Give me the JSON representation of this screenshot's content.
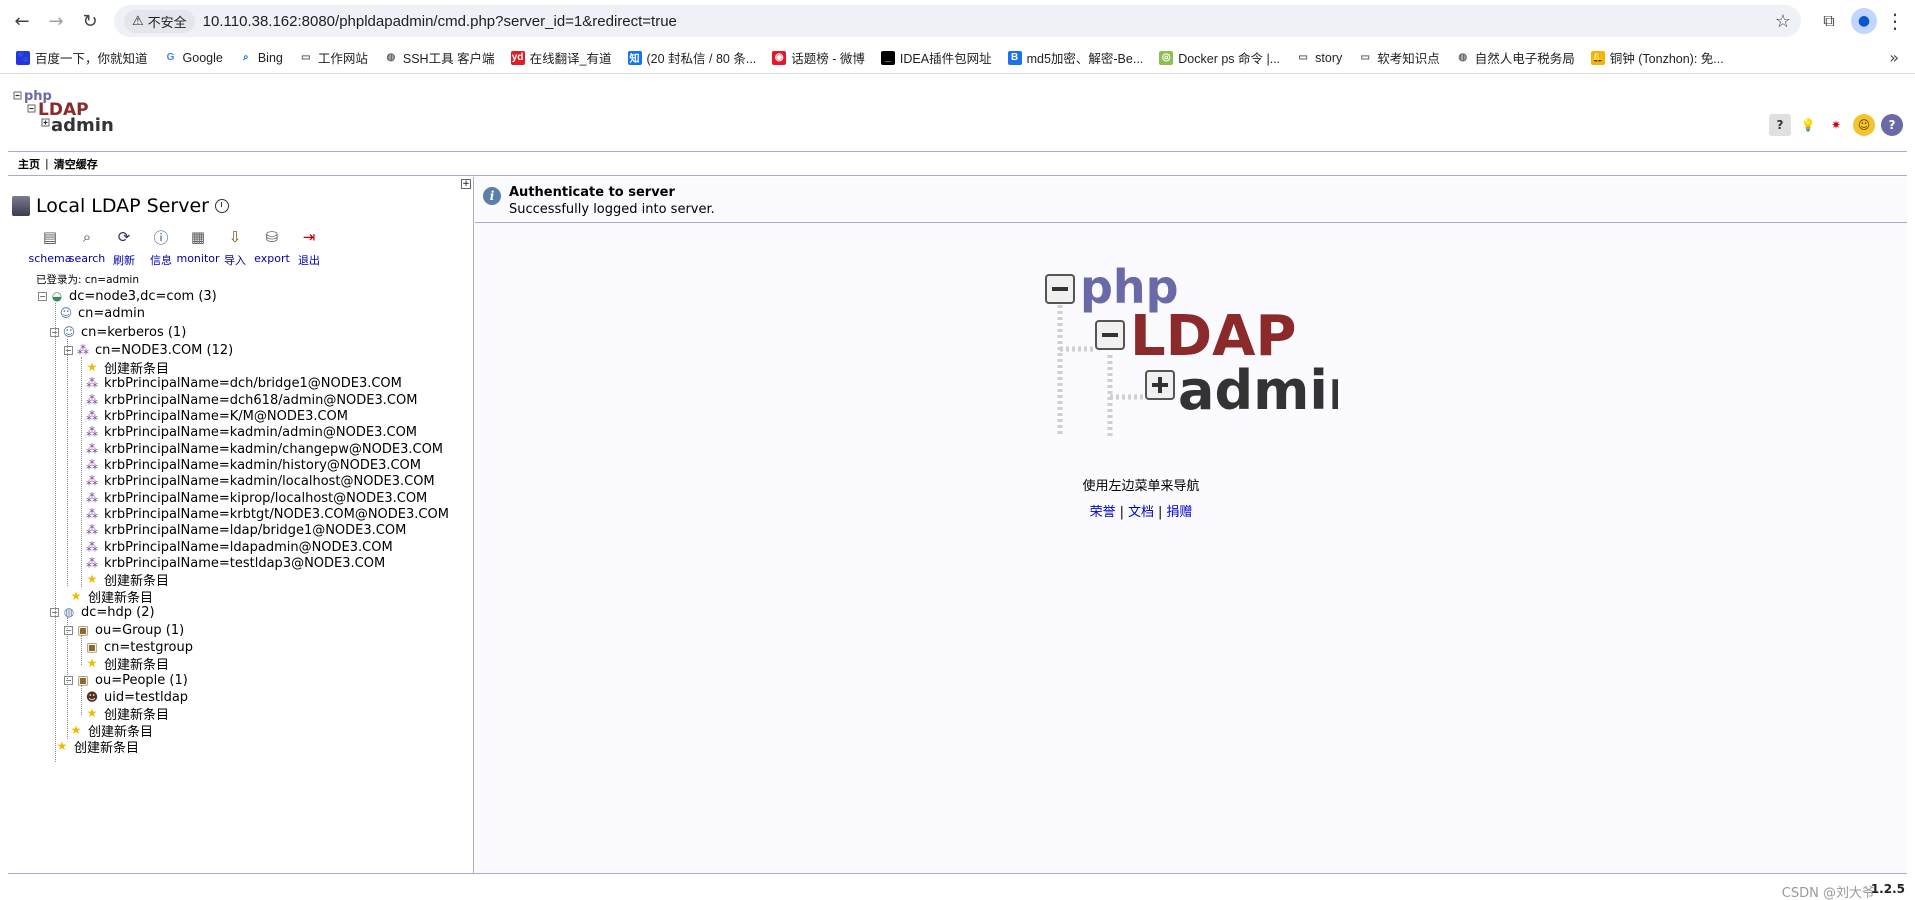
{
  "browser": {
    "secure_label": "不安全",
    "url": "10.110.38.162:8080/phpldapadmin/cmd.php?server_id=1&redirect=true",
    "bookmarks": [
      {
        "label": "百度一下，你就知道",
        "icon": "baidu-icon",
        "color": "#2932e1"
      },
      {
        "label": "Google",
        "icon": "google-icon",
        "color": "#4285f4"
      },
      {
        "label": "Bing",
        "icon": "search-icon",
        "color": "#1a73e8"
      },
      {
        "label": "工作网站",
        "icon": "folder-icon",
        "color": "#5f6368"
      },
      {
        "label": "SSH工具 客户端",
        "icon": "globe-icon",
        "color": "#5f6368"
      },
      {
        "label": "在线翻译_有道",
        "icon": "youdao-icon",
        "color": "#e31b23"
      },
      {
        "label": "(20 封私信 / 80 条...",
        "icon": "zhihu-icon",
        "color": "#1772f6"
      },
      {
        "label": "话题榜 - 微博",
        "icon": "weibo-icon",
        "color": "#e6162d"
      },
      {
        "label": "IDEA插件包网址",
        "icon": "terminal-icon",
        "color": "#000000"
      },
      {
        "label": "md5加密、解密-Be...",
        "icon": "bejson-icon",
        "color": "#1a73e8"
      },
      {
        "label": "Docker ps 命令 |...",
        "icon": "runoob-icon",
        "color": "#8cc152"
      },
      {
        "label": "story",
        "icon": "folder-icon",
        "color": "#5f6368"
      },
      {
        "label": "软考知识点",
        "icon": "folder-icon",
        "color": "#5f6368"
      },
      {
        "label": "自然人电子税务局",
        "icon": "globe-icon",
        "color": "#5f6368"
      },
      {
        "label": "铜钟 (Tonzhon): 免...",
        "icon": "bell-icon",
        "color": "#f4b400"
      }
    ]
  },
  "menubar": {
    "home": "主页",
    "sep": "|",
    "purge": "清空缓存"
  },
  "server": {
    "title": "Local LDAP Server",
    "logged_in": "已登录为: cn=admin"
  },
  "tools": [
    {
      "label": "schema",
      "icon": "schema-icon"
    },
    {
      "label": "search",
      "icon": "search-icon"
    },
    {
      "label": "刷新",
      "icon": "refresh-icon"
    },
    {
      "label": "信息",
      "icon": "info-icon"
    },
    {
      "label": "monitor",
      "icon": "monitor-icon"
    },
    {
      "label": "导入",
      "icon": "import-icon"
    },
    {
      "label": "export",
      "icon": "export-icon"
    },
    {
      "label": "退出",
      "icon": "logout-icon"
    }
  ],
  "tree": [
    {
      "label": "dc=node3,dc=com (3)",
      "icon": "domain-icon"
    },
    {
      "label": "cn=admin",
      "icon": "user-icon"
    },
    {
      "label": "cn=kerberos (1)",
      "icon": "user-icon"
    },
    {
      "label": "cn=NODE3.COM (12)",
      "icon": "group-icon"
    },
    {
      "label": "创建新条目",
      "icon": "star-icon"
    },
    {
      "label": "krbPrincipalName=dch/bridge1@NODE3.COM",
      "icon": "group-icon"
    },
    {
      "label": "krbPrincipalName=dch618/admin@NODE3.COM",
      "icon": "group-icon"
    },
    {
      "label": "krbPrincipalName=K/M@NODE3.COM",
      "icon": "group-icon"
    },
    {
      "label": "krbPrincipalName=kadmin/admin@NODE3.COM",
      "icon": "group-icon"
    },
    {
      "label": "krbPrincipalName=kadmin/changepw@NODE3.COM",
      "icon": "group-icon"
    },
    {
      "label": "krbPrincipalName=kadmin/history@NODE3.COM",
      "icon": "group-icon"
    },
    {
      "label": "krbPrincipalName=kadmin/localhost@NODE3.COM",
      "icon": "group-icon"
    },
    {
      "label": "krbPrincipalName=kiprop/localhost@NODE3.COM",
      "icon": "group-icon"
    },
    {
      "label": "krbPrincipalName=krbtgt/NODE3.COM@NODE3.COM",
      "icon": "group-icon"
    },
    {
      "label": "krbPrincipalName=ldap/bridge1@NODE3.COM",
      "icon": "group-icon"
    },
    {
      "label": "krbPrincipalName=ldapadmin@NODE3.COM",
      "icon": "group-icon"
    },
    {
      "label": "krbPrincipalName=testldap3@NODE3.COM",
      "icon": "group-icon"
    },
    {
      "label": "创建新条目",
      "icon": "star-icon"
    },
    {
      "label": "创建新条目",
      "icon": "star-icon"
    },
    {
      "label": "dc=hdp (2)",
      "icon": "globe-icon"
    },
    {
      "label": "ou=Group (1)",
      "icon": "ou-icon"
    },
    {
      "label": "cn=testgroup",
      "icon": "ou-icon"
    },
    {
      "label": "创建新条目",
      "icon": "star-icon"
    },
    {
      "label": "ou=People (1)",
      "icon": "ou-icon"
    },
    {
      "label": "uid=testldap",
      "icon": "person-icon"
    },
    {
      "label": "创建新条目",
      "icon": "star-icon"
    },
    {
      "label": "创建新条目",
      "icon": "star-icon"
    },
    {
      "label": "创建新条目",
      "icon": "star-icon"
    }
  ],
  "notice": {
    "title": "Authenticate to server",
    "text": "Successfully logged into server."
  },
  "main": {
    "hint": "使用左边菜单来导航",
    "links": [
      "荣誉",
      "文档",
      "捐赠"
    ],
    "sep": "|"
  },
  "footer": {
    "version": "1.2.5",
    "watermark": "CSDN @刘大爷"
  },
  "colors": {
    "link": "#0000cc",
    "border": "#aaaacc",
    "logo_purple": "#6a6aa8",
    "logo_red": "#8b2a2a",
    "logo_dark": "#333333"
  }
}
